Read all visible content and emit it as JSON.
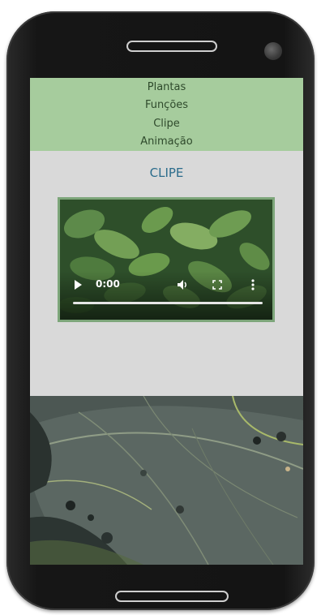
{
  "nav": {
    "items": [
      {
        "label": "Plantas"
      },
      {
        "label": "Funções"
      },
      {
        "label": "Clipe"
      },
      {
        "label": "Animação"
      }
    ]
  },
  "main": {
    "title": "CLIPE"
  },
  "video": {
    "time": "0:00",
    "progress": 0,
    "play_icon": "play-icon",
    "volume_icon": "volume-icon",
    "fullscreen_icon": "fullscreen-icon",
    "menu_icon": "more-vertical-icon"
  },
  "colors": {
    "nav_bg": "#a6cc9d",
    "title": "#2b6c8c",
    "screen_bg": "#d9d9d9"
  }
}
